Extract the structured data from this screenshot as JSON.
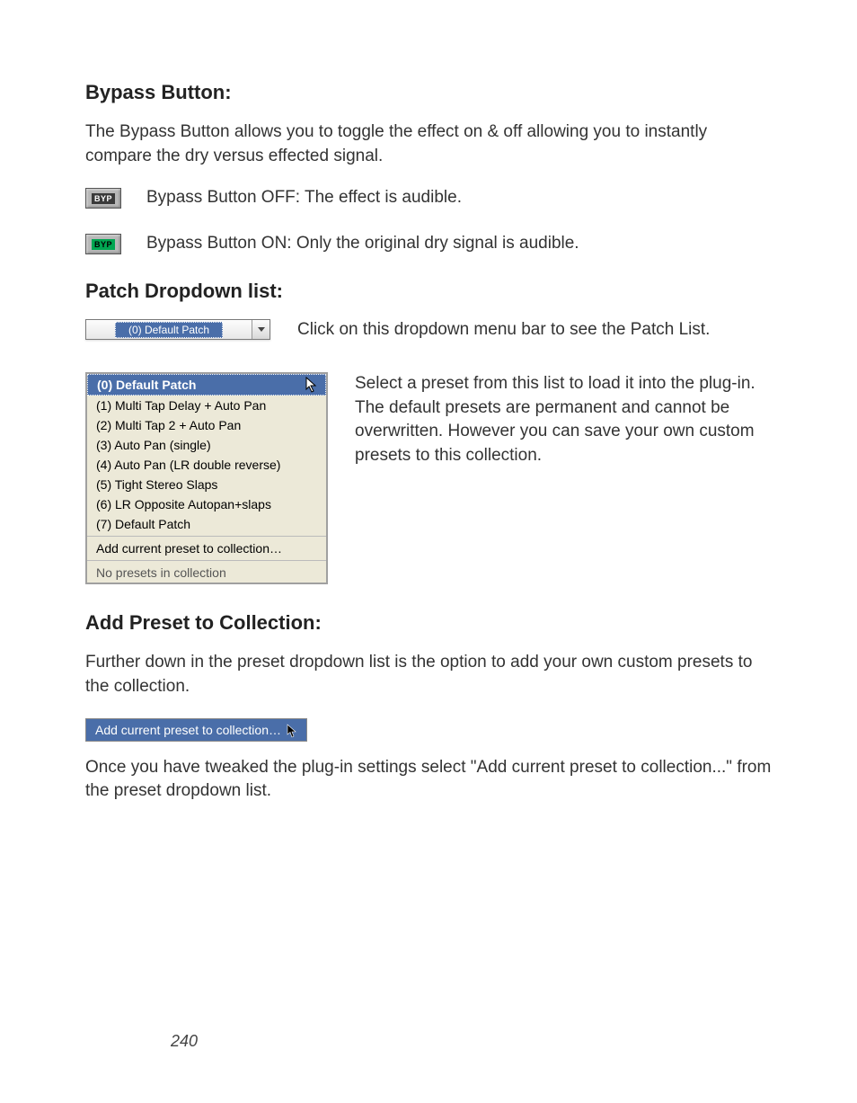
{
  "sections": {
    "bypass": {
      "heading": "Bypass Button:",
      "intro": "The Bypass Button allows you to toggle the effect on & off allowing you to instantly compare the dry versus effected signal.",
      "off_label": "BYP",
      "off_text": "Bypass Button OFF:  The effect is audible.",
      "on_label": "BYP",
      "on_text": "Bypass Button ON:  Only the original dry signal is audible."
    },
    "patch": {
      "heading": "Patch Dropdown list:",
      "selected": "(0) Default Patch",
      "click_text": "Click on this dropdown menu bar to see the Patch List.",
      "list_items": [
        "(0)   Default Patch",
        "(1) Multi Tap Delay + Auto Pan",
        "(2) Multi Tap 2 + Auto Pan",
        "(3) Auto Pan (single)",
        "(4) Auto Pan (LR double reverse)",
        "(5) Tight Stereo Slaps",
        "(6) LR Opposite Autopan+slaps",
        "(7)  Default Patch"
      ],
      "add_item": "Add current preset to collection…",
      "no_presets": "No presets in collection",
      "select_text": "Select a preset from this list to load it into the plug-in.  The default presets are permanent and cannot be overwritten.  However you can save your own custom presets to this collection."
    },
    "add": {
      "heading": "Add Preset to Collection:",
      "intro": "Further down in the preset dropdown list is the option to add your own custom presets to the collection.",
      "bar_text": "Add current preset to collection…",
      "outro": "Once you have tweaked the plug-in settings select \"Add current preset to collection...\" from the preset dropdown list."
    }
  },
  "page_number": "240"
}
